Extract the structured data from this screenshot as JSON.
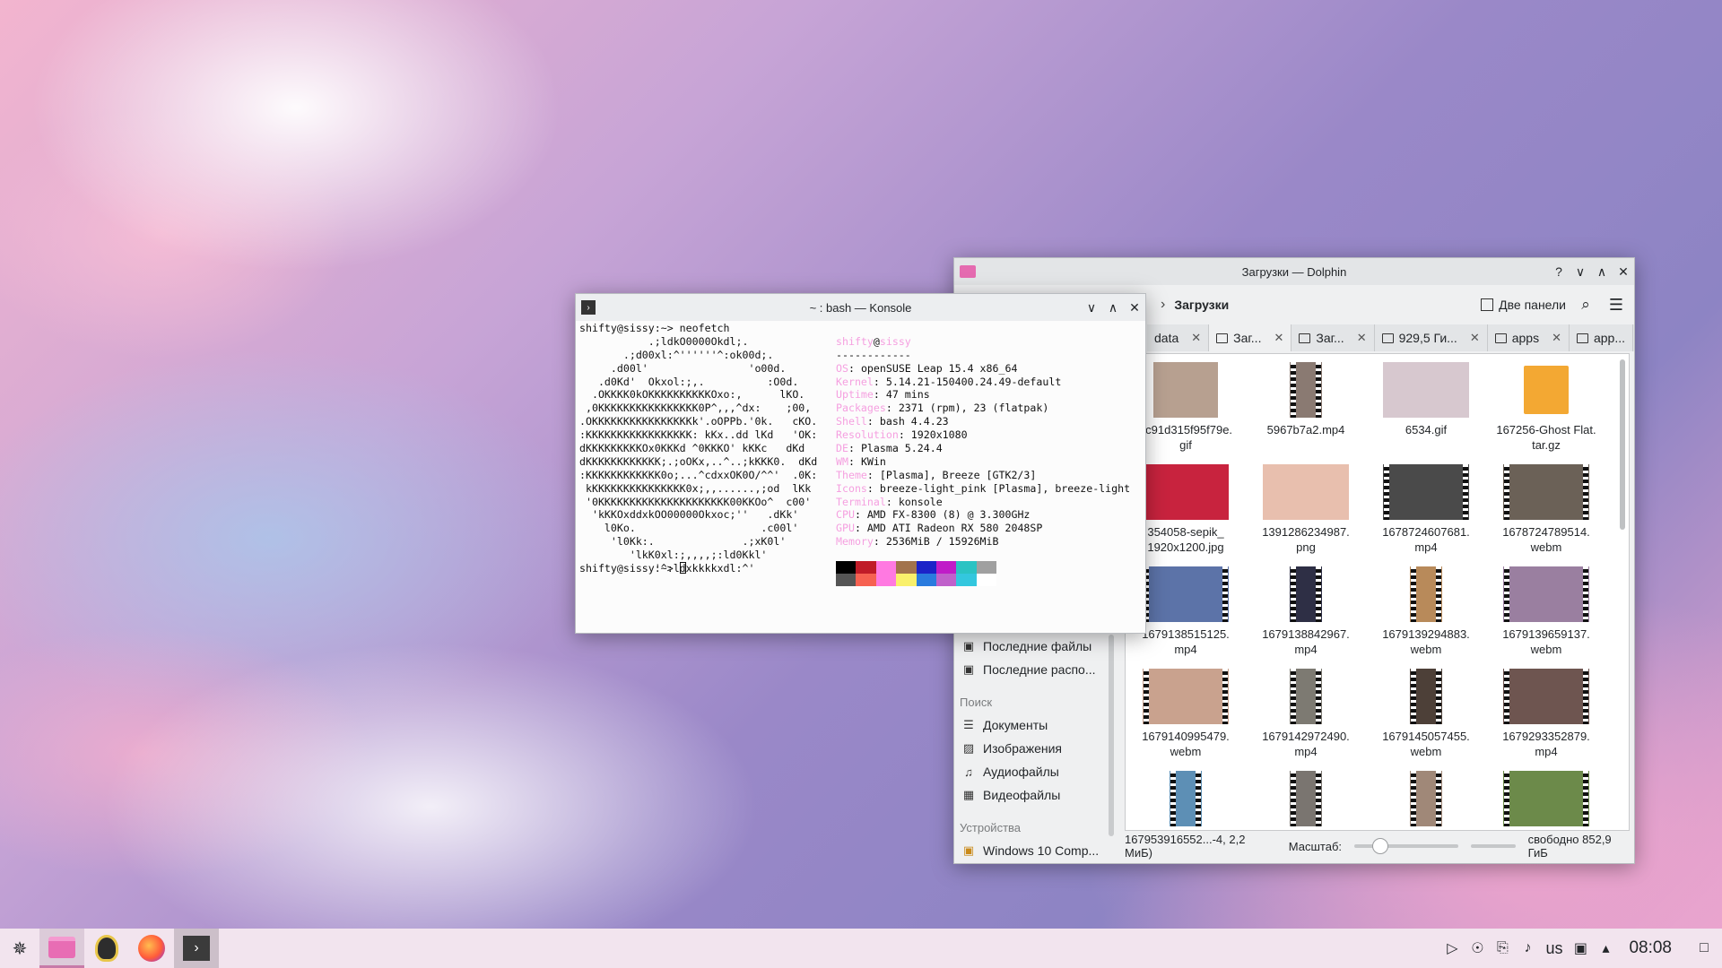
{
  "taskbar": {
    "launcher_icon": "kde-launcher-icon",
    "tasks": [
      {
        "name": "dolphin",
        "icon": "pink-folder-icon"
      },
      {
        "name": "tux",
        "icon": "tux-penguin-icon"
      },
      {
        "name": "firefox",
        "icon": "firefox-icon"
      },
      {
        "name": "konsole",
        "icon": "terminal-icon"
      }
    ],
    "tray": {
      "keyboard_layout": "us",
      "clock": "08:08"
    }
  },
  "dolphin": {
    "title": "Загрузки — Dolphin",
    "breadcrumb": "Загрузки",
    "split_label": "Две панели",
    "tabs": [
      "data",
      "Заг...",
      "Заг...",
      "929,5 Ги...",
      "apps",
      "app..."
    ],
    "sidebar": {
      "recent": [
        "Последние файлы",
        "Последние распо..."
      ],
      "search_header": "Поиск",
      "search": [
        "Документы",
        "Изображения",
        "Аудиофайлы",
        "Видеофайлы"
      ],
      "devices_header": "Устройства",
      "devices": [
        "Windows 10 Comp..."
      ]
    },
    "files": [
      {
        "name": "0c91d315f95f79e.\ngif",
        "kind": "image",
        "color": "#b7a090"
      },
      {
        "name": "5967b7a2.mp4",
        "kind": "video-tall",
        "color": "#8a7a72"
      },
      {
        "name": "6534.gif",
        "kind": "image",
        "color": "#d7c8cf"
      },
      {
        "name": "167256-Ghost Flat.\ntar.gz",
        "kind": "archive",
        "color": "#f3a833"
      },
      {
        "name": "354058-sepik_\n1920x1200.jpg",
        "kind": "image",
        "color": "#c8233e"
      },
      {
        "name": "1391286234987.\npng",
        "kind": "image",
        "color": "#e8bfae"
      },
      {
        "name": "1678724607681.\nmp4",
        "kind": "video",
        "color": "#4a4a4a"
      },
      {
        "name": "1678724789514.\nwebm",
        "kind": "video",
        "color": "#6b6157"
      },
      {
        "name": "1679138515125.\nmp4",
        "kind": "video",
        "color": "#5c73a8"
      },
      {
        "name": "1679138842967.\nmp4",
        "kind": "video-tall",
        "color": "#2e2f45"
      },
      {
        "name": "1679139294883.\nwebm",
        "kind": "video-tall",
        "color": "#b88a5a"
      },
      {
        "name": "1679139659137.\nwebm",
        "kind": "video",
        "color": "#9a7fa0"
      },
      {
        "name": "1679140995479.\nwebm",
        "kind": "video",
        "color": "#c9a28e"
      },
      {
        "name": "1679142972490.\nmp4",
        "kind": "video-tall",
        "color": "#7d7a72"
      },
      {
        "name": "1679145057455.\nwebm",
        "kind": "video-tall",
        "color": "#4d4038"
      },
      {
        "name": "1679293352879.\nmp4",
        "kind": "video",
        "color": "#6e5550"
      },
      {
        "name": "",
        "kind": "video-tall",
        "color": "#5d8fb5"
      },
      {
        "name": "",
        "kind": "video-tall",
        "color": "#7a7570"
      },
      {
        "name": "",
        "kind": "video-tall",
        "color": "#a08878"
      },
      {
        "name": "",
        "kind": "video",
        "color": "#6c8a4a"
      }
    ],
    "status": {
      "selection": "167953916552...-4, 2,2 МиБ)",
      "zoom_label": "Масштаб:",
      "zoom_level": 0.2,
      "free_space": "свободно 852,9 ГиБ"
    }
  },
  "konsole": {
    "title": "~ : bash — Konsole",
    "prompt_line": "shifty@sissy:~> neofetch",
    "logo": [
      "           .;ldkO0000Okdl;.",
      "       .;d00xl:^''''''^:ok00d;.",
      "     .d00l'                'o00d.",
      "   .d0Kd'  Okxol:;,.          :O0d.",
      "  .OKKKK0kOKKKKKKKKKKOxo:,      lKO.",
      " ,0KKKKKKKKKKKKKKKK0P^,,,^dx:    ;00,",
      ".OKKKKKKKKKKKKKKKKk'.oOPPb.'0k.   cKO.",
      ":KKKKKKKKKKKKKKKKK: kKx..dd lKd   'OK:",
      "dKKKKKKKKKOx0KKKd ^0KKKO' kKKc   dKd",
      "dKKKKKKKKKKKK;.;oOKx,..^..;kKKK0.  dKd",
      ":KKKKKKKKKKKK0o;...^cdxxOK0O/^^'  .0K:",
      " kKKKKKKKKKKKKKKK0x;,,......,;od  lKk",
      " '0KKKKKKKKKKKKKKKKKKKKK00KKOo^  c00'",
      "  'kKKOxddxkOO00000Okxoc;''   .dKk'",
      "    l0Ko.                    .c00l'",
      "     'l0Kk:.              .;xK0l'",
      "        'lkK0xl:;,,,,;:ld0Kkl'",
      "            '^:ldxkkkkxdl:^'"
    ],
    "info_user": "shifty",
    "info_host": "sissy",
    "info_sep": "------------",
    "info": [
      {
        "key": "OS",
        "value": "openSUSE Leap 15.4 x86_64"
      },
      {
        "key": "Kernel",
        "value": "5.14.21-150400.24.49-default"
      },
      {
        "key": "Uptime",
        "value": "47 mins"
      },
      {
        "key": "Packages",
        "value": "2371 (rpm), 23 (flatpak)"
      },
      {
        "key": "Shell",
        "value": "bash 4.4.23"
      },
      {
        "key": "Resolution",
        "value": "1920x1080"
      },
      {
        "key": "DE",
        "value": "Plasma 5.24.4"
      },
      {
        "key": "WM",
        "value": "KWin"
      },
      {
        "key": "Theme",
        "value": "[Plasma], Breeze [GTK2/3]"
      },
      {
        "key": "Icons",
        "value": "breeze-light_pink [Plasma], breeze-light"
      },
      {
        "key": "Terminal",
        "value": "konsole"
      },
      {
        "key": "CPU",
        "value": "AMD FX-8300 (8) @ 3.300GHz"
      },
      {
        "key": "GPU",
        "value": "AMD ATI Radeon RX 580 2048SP"
      },
      {
        "key": "Memory",
        "value": "2536MiB / 15926MiB"
      }
    ],
    "palette_top": [
      "#000000",
      "#c01c28",
      "#ff79e1",
      "#a2734c",
      "#1c23c8",
      "#c01cc8",
      "#2ac3c3",
      "#a0a0a0"
    ],
    "palette_bottom": [
      "#555555",
      "#f66151",
      "#ff79e1",
      "#f9f06b",
      "#2a7bde",
      "#c061cb",
      "#33c7de",
      "#ffffff"
    ],
    "final_prompt": "shifty@sissy:~> "
  }
}
